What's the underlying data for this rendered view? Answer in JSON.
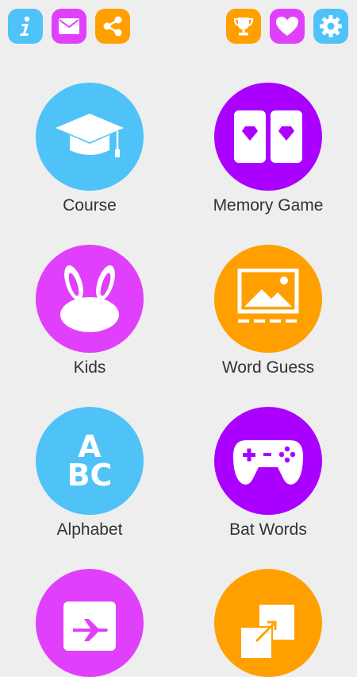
{
  "colors": {
    "blue": "#4fc3f7",
    "magenta": "#e040fb",
    "orange": "#ffa000",
    "purple": "#aa00ff",
    "background": "#eeeeee",
    "label": "#333333"
  },
  "toolbar": {
    "left": [
      {
        "icon": "info-icon",
        "color": "#4fc3f7"
      },
      {
        "icon": "mail-icon",
        "color": "#e040fb"
      },
      {
        "icon": "share-icon",
        "color": "#ffa000"
      }
    ],
    "right": [
      {
        "icon": "trophy-icon",
        "color": "#ffa000"
      },
      {
        "icon": "heart-icon",
        "color": "#e040fb"
      },
      {
        "icon": "gear-icon",
        "color": "#4fc3f7"
      }
    ]
  },
  "menu": [
    {
      "label": "Course",
      "icon": "graduation-cap-icon",
      "color": "#4fc3f7"
    },
    {
      "label": "Memory Game",
      "icon": "cards-icon",
      "color": "#aa00ff"
    },
    {
      "label": "Kids",
      "icon": "bunny-icon",
      "color": "#e040fb"
    },
    {
      "label": "Word Guess",
      "icon": "picture-guess-icon",
      "color": "#ffa000"
    },
    {
      "label": "Alphabet",
      "icon": "abc-icon",
      "color": "#4fc3f7",
      "glyph_top": "A",
      "glyph_bottom": "BC"
    },
    {
      "label": "Bat Words",
      "icon": "gamepad-icon",
      "color": "#aa00ff"
    },
    {
      "label": "",
      "icon": "airplane-icon",
      "color": "#e040fb"
    },
    {
      "label": "",
      "icon": "resize-icon",
      "color": "#ffa000"
    }
  ]
}
